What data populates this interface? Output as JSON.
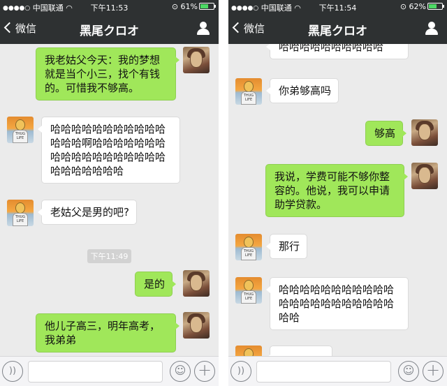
{
  "status_left": {
    "carrier": "中国联通",
    "time": "下午11:53",
    "battery": "61%",
    "battery_level": 0.61
  },
  "status_right": {
    "carrier": "中国联通",
    "time": "下午11:54",
    "battery": "62%",
    "battery_level": 0.62
  },
  "nav": {
    "back_label": "微信",
    "title": "黑尾クロオ"
  },
  "avatar_badge": "THUG LIFE",
  "left_chat": {
    "msg1": "我老姑父今天：我的梦想就是当个小三，找个有钱的。可惜我不够高。",
    "msg2": "哈哈哈哈哈哈哈哈哈哈哈哈哈哈啊哈哈哈哈哈哈哈哈哈哈哈哈哈哈哈哈哈哈哈哈哈哈哈哈哈",
    "msg3": "老姑父是男的吧?",
    "timestamp": "下午11:49",
    "msg4": "是的",
    "msg5": "他儿子高三，明年高考，我弟弟"
  },
  "right_chat": {
    "msg0": "哈哈哈哈哈哈哈哈哈哈",
    "msg1": "你弟够高吗",
    "msg2": "够高",
    "msg3": "我说，学费可能不够你整容的。他说，我可以申请助学贷款。",
    "msg4": "那行",
    "msg5": "哈哈哈哈哈哈哈哈哈哈哈哈哈哈哈哈哈哈哈哈哈哈哈哈"
  }
}
